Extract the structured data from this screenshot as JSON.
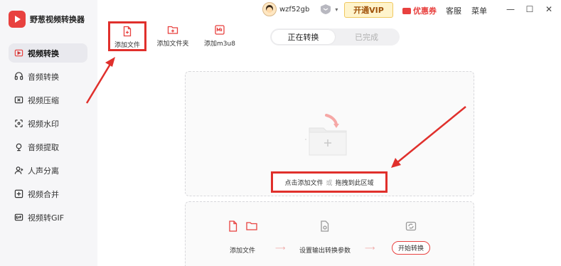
{
  "app": {
    "name": "野葱视频转换器"
  },
  "sidebar": {
    "items": [
      {
        "label": "视频转换",
        "icon": "video-convert-icon"
      },
      {
        "label": "音频转换",
        "icon": "audio-convert-icon"
      },
      {
        "label": "视频压缩",
        "icon": "video-compress-icon"
      },
      {
        "label": "视频水印",
        "icon": "watermark-icon"
      },
      {
        "label": "音频提取",
        "icon": "audio-extract-icon"
      },
      {
        "label": "人声分离",
        "icon": "voice-separate-icon"
      },
      {
        "label": "视频合并",
        "icon": "video-merge-icon"
      },
      {
        "label": "视频转GIF",
        "icon": "gif-icon"
      }
    ],
    "active_index": 0
  },
  "topbar": {
    "username": "wzf52gb",
    "vip_label": "开通VIP",
    "coupon_label": "优惠券",
    "service_label": "客服",
    "menu_label": "菜单",
    "window_controls": [
      "minimize-icon",
      "maximize-icon",
      "close-icon"
    ]
  },
  "toolbar": {
    "add_file": "添加文件",
    "add_folder": "添加文件夹",
    "add_m3u8": "添加m3u8"
  },
  "tabs": {
    "converting": "正在转换",
    "completed": "已完成"
  },
  "drop_area": {
    "hint_main": "点击添加文件",
    "hint_or": "或",
    "hint_drag": "拖拽到此区域"
  },
  "steps": {
    "step1": "添加文件",
    "step2": "设置输出转换参数",
    "step3": "开始转换"
  },
  "colors": {
    "accent": "#e8413f",
    "annotation": "#e0302c",
    "vip_bg": "#fff4cc"
  }
}
